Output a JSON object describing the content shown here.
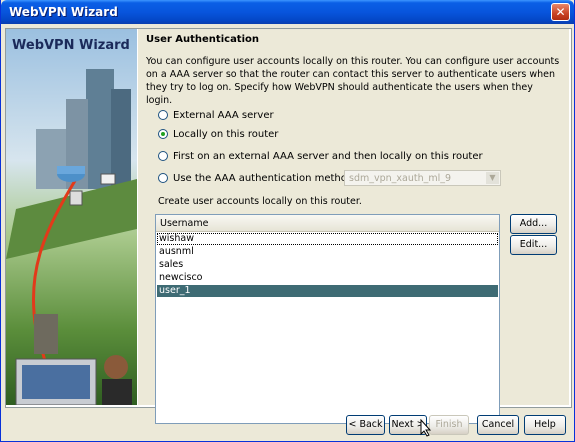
{
  "window": {
    "title": "WebVPN Wizard",
    "close_glyph": "✕"
  },
  "side_panel": {
    "title": "WebVPN Wizard"
  },
  "main": {
    "section_title": "User Authentication",
    "description": "You can configure user accounts locally on this router. You can configure user accounts on a AAA server so that the router can contact this server to authenticate users when they try to log on. Specify how WebVPN should authenticate the users when they login.",
    "auth_options": [
      {
        "label": "External AAA server",
        "checked": false
      },
      {
        "label": "Locally on this router",
        "checked": true
      },
      {
        "label": "First on an external AAA server and then locally on this router",
        "checked": false
      },
      {
        "label": "Use the AAA authentication method list:",
        "checked": false
      }
    ],
    "method_list": {
      "value": "sdm_vpn_xauth_ml_9",
      "arrow": "▼"
    },
    "accounts_caption": "Create user accounts locally on this router.",
    "table": {
      "column": "Username",
      "rows": [
        "wishaw",
        "ausnml",
        "sales",
        "newcisco",
        "user_1"
      ],
      "selected_index": 4
    },
    "add_label": "Add...",
    "edit_label": "Edit..."
  },
  "footer": {
    "back_label": "< Back",
    "next_label": "Next >",
    "finish_label": "Finish",
    "cancel_label": "Cancel",
    "help_label": "Help"
  },
  "colors": {
    "title_bar": "#0855dd",
    "selection": "#3e6b74",
    "dialog_bg": "#ece9d8"
  }
}
